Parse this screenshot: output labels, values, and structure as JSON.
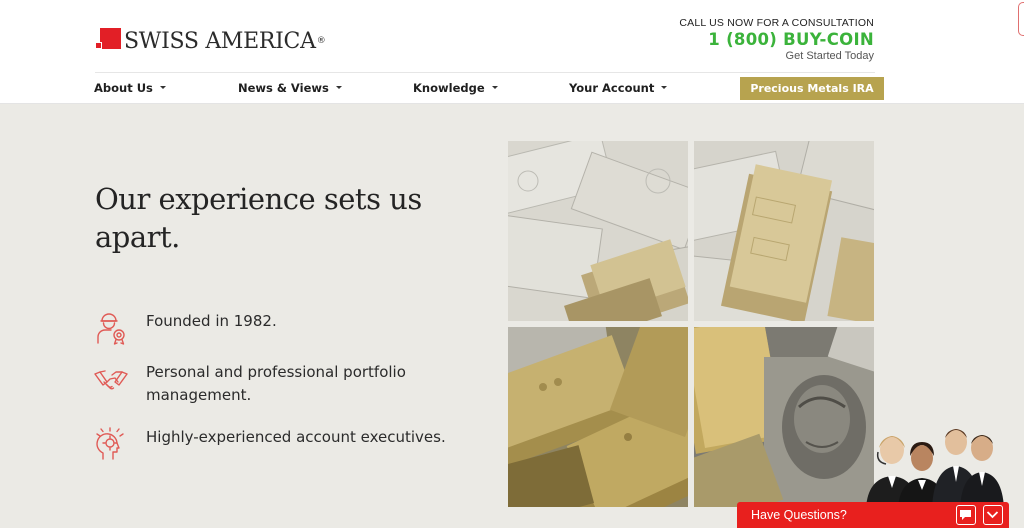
{
  "brand": {
    "logo_text": "SWISS AMERICA",
    "logo_mark": "®"
  },
  "contact": {
    "call_label": "CALL US NOW FOR A CONSULTATION",
    "phone": "1 (800) BUY-COIN",
    "subtext": "Get Started Today"
  },
  "nav": {
    "items": [
      {
        "label": "About Us"
      },
      {
        "label": "News & Views"
      },
      {
        "label": "Knowledge"
      },
      {
        "label": "Your Account"
      }
    ],
    "cta_label": "Precious Metals IRA"
  },
  "hero": {
    "headline": "Our experience sets us apart.",
    "features": [
      {
        "icon": "worker-badge-icon",
        "text": "Founded in 1982."
      },
      {
        "icon": "handshake-icon",
        "text": "Personal and professional portfolio management."
      },
      {
        "icon": "head-idea-icon",
        "text": "Highly-experienced account executives."
      }
    ],
    "image": "gold-bars-and-dollar-bills-photo"
  },
  "chat": {
    "label": "Have Questions?",
    "icons": [
      "chat-bubble-icon",
      "chevron-down-icon"
    ]
  },
  "colors": {
    "brand_red": "#e21f26",
    "phone_green": "#3bb33b",
    "cta_gold": "#b7a34f",
    "hero_bg": "#ebeae5",
    "chat_red": "#e8201e",
    "icon_red": "#e05a55"
  }
}
